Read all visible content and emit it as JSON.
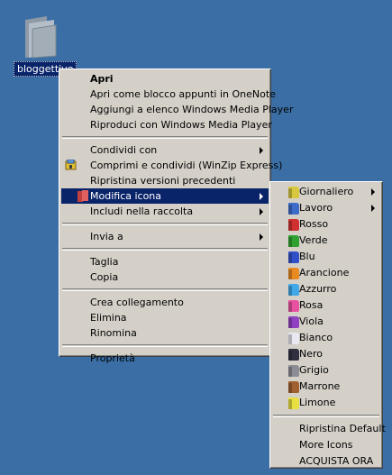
{
  "desktop": {
    "folder_label": "bloggettivo",
    "background": "#3a6ea5"
  },
  "context_menu": {
    "items": [
      {
        "label": "Apri",
        "bold": true
      },
      {
        "label": "Apri come blocco appunti in OneNote"
      },
      {
        "label": "Aggiungi a elenco Windows Media Player"
      },
      {
        "label": "Riproduci con Windows Media Player"
      },
      {
        "label": "Condividi con",
        "submenu": true
      },
      {
        "label": "Comprimi e condividi (WinZip Express)",
        "icon": "winzip-icon"
      },
      {
        "label": "Ripristina versioni precedenti"
      },
      {
        "label": "Modifica icona",
        "submenu": true,
        "highlighted": true,
        "icon": "folder-color-icon"
      },
      {
        "label": "Includi nella raccolta",
        "submenu": true
      },
      {
        "label": "Invia a",
        "submenu": true
      },
      {
        "label": "Taglia"
      },
      {
        "label": "Copia"
      },
      {
        "label": "Crea collegamento"
      },
      {
        "label": "Elimina"
      },
      {
        "label": "Rinomina"
      },
      {
        "label": "Proprietà"
      }
    ]
  },
  "icon_submenu": {
    "items": [
      {
        "label": "Giornaliero",
        "submenu": true,
        "color": "#d8c840"
      },
      {
        "label": "Lavoro",
        "submenu": true,
        "color": "#3c6cc8"
      },
      {
        "label": "Rosso",
        "color": "#d03030"
      },
      {
        "label": "Verde",
        "color": "#30a030"
      },
      {
        "label": "Blu",
        "color": "#3050c8"
      },
      {
        "label": "Arancione",
        "color": "#e88a20"
      },
      {
        "label": "Azzurro",
        "color": "#40a8e8"
      },
      {
        "label": "Rosa",
        "color": "#e850a0"
      },
      {
        "label": "Viola",
        "color": "#9040c0"
      },
      {
        "label": "Bianco",
        "color": "#e8e8f0"
      },
      {
        "label": "Nero",
        "color": "#303040"
      },
      {
        "label": "Grigio",
        "color": "#8c8c94"
      },
      {
        "label": "Marrone",
        "color": "#a06030"
      },
      {
        "label": "Limone",
        "color": "#e8e040"
      },
      {
        "label": "Ripristina Default"
      },
      {
        "label": "More Icons"
      },
      {
        "label": "ACQUISTA ORA"
      }
    ]
  }
}
